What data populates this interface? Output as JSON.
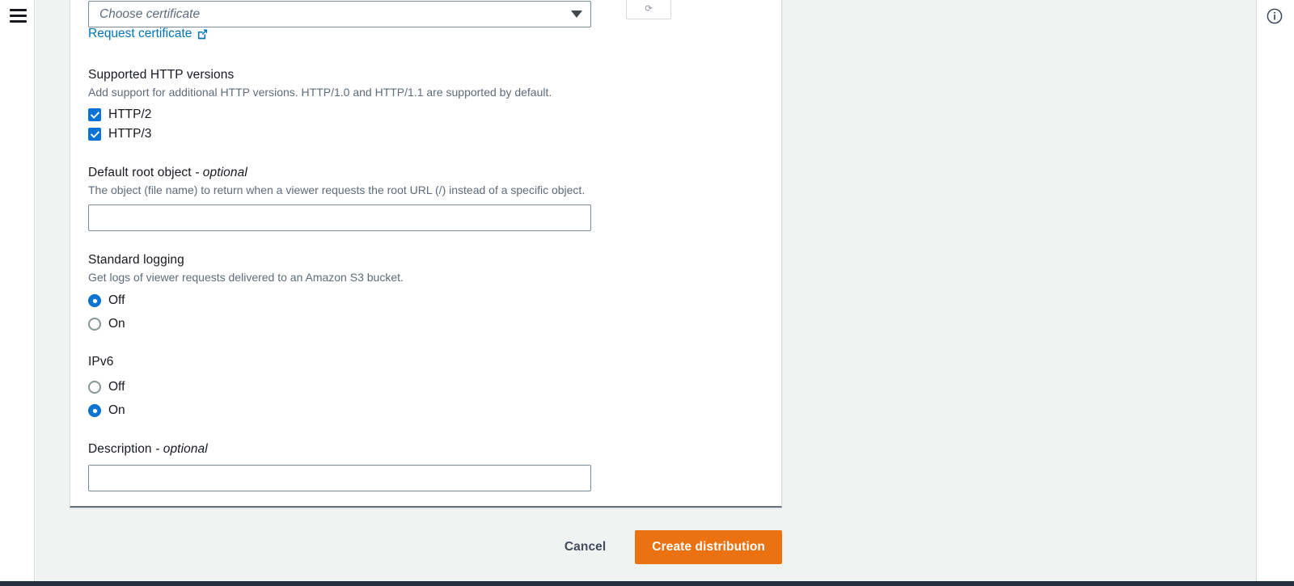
{
  "nav": {
    "menu_icon": "hamburger-menu-icon"
  },
  "certificate": {
    "select_placeholder": "Choose certificate",
    "refresh_icon": "refresh-icon",
    "request_link": "Request certificate",
    "request_link_icon": "external-link-icon"
  },
  "http_versions": {
    "label": "Supported HTTP versions",
    "description": "Add support for additional HTTP versions. HTTP/1.0 and HTTP/1.1 are supported by default.",
    "options": [
      {
        "label": "HTTP/2",
        "checked": true
      },
      {
        "label": "HTTP/3",
        "checked": true
      }
    ]
  },
  "default_root_object": {
    "label": "Default root object",
    "optional_suffix": "- optional",
    "description": "The object (file name) to return when a viewer requests the root URL (/) instead of a specific object.",
    "value": "",
    "placeholder": ""
  },
  "standard_logging": {
    "label": "Standard logging",
    "description": "Get logs of viewer requests delivered to an Amazon S3 bucket.",
    "options": [
      {
        "label": "Off",
        "selected": true
      },
      {
        "label": "On",
        "selected": false
      }
    ]
  },
  "ipv6": {
    "label": "IPv6",
    "options": [
      {
        "label": "Off",
        "selected": false
      },
      {
        "label": "On",
        "selected": true
      }
    ]
  },
  "description_field": {
    "label": "Description",
    "optional_suffix": "- optional",
    "value": "",
    "placeholder": ""
  },
  "footer": {
    "cancel_label": "Cancel",
    "submit_label": "Create distribution"
  },
  "help_panel": {
    "info_icon": "info-circle-icon"
  },
  "colors": {
    "accent_blue": "#0972d3",
    "link_blue": "#0073bb",
    "primary_orange": "#ec7211",
    "page_background": "#f1f3f3",
    "text_dark": "#16191f",
    "text_muted": "#5f6b7a"
  }
}
